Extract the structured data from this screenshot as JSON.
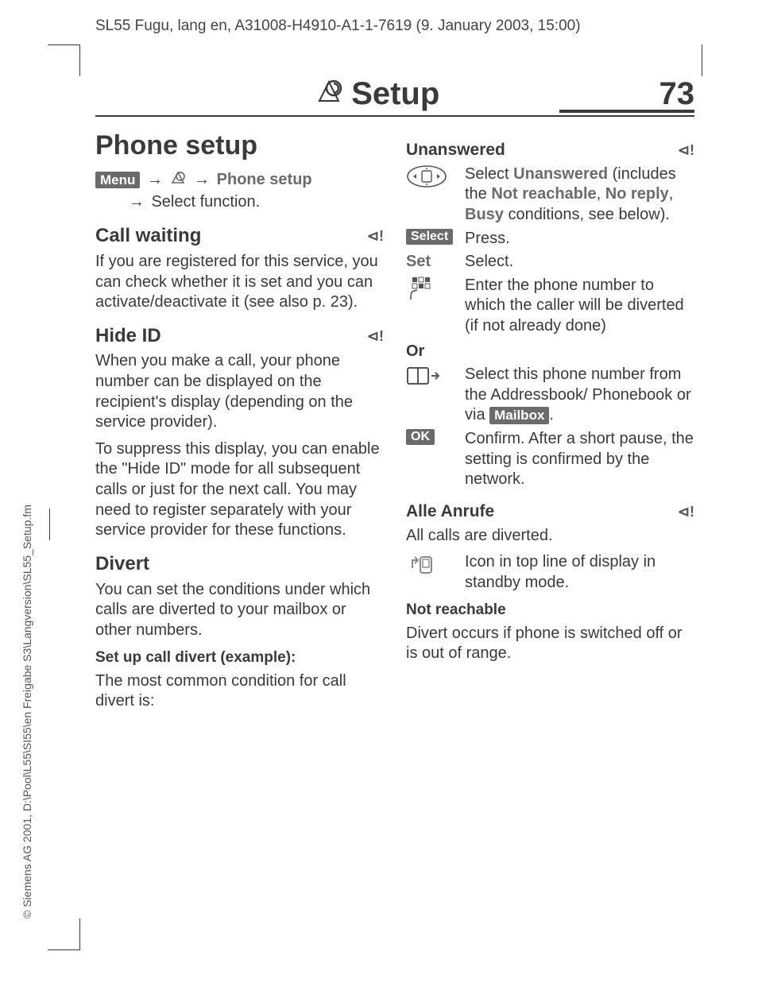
{
  "header": "SL55 Fugu, lang en, A31008-H4910-A1-1-7619 (9. January 2003, 15:00)",
  "side": "© Siemens AG 2001, D:\\Pool\\L55\\SI55\\en Freigabe S3\\Langversion\\SL55_Setup.fm",
  "page_title": "Setup",
  "page_num": "73",
  "left": {
    "h1": "Phone setup",
    "menu_label": "Menu",
    "nav_phone_setup": "Phone setup",
    "nav_select_fn": "Select function.",
    "call_waiting": {
      "title": "Call waiting",
      "body": "If you are registered for this service, you can check whether it is set and you can activate/deactivate it (see also p. 23)."
    },
    "hide_id": {
      "title": "Hide ID",
      "p1": "When you make a call, your phone number can be displayed on the recipient's display (depending on the service provider).",
      "p2": "To suppress this display, you can enable the \"Hide ID\" mode for all subsequent calls or just for the next call. You may need to register separately with your service provider for these functions."
    },
    "divert": {
      "title": "Divert",
      "p1": "You can set the conditions under which calls are diverted to your mailbox or other numbers.",
      "sub": "Set up call divert (example):",
      "p2": "The most common condition for call divert is:"
    }
  },
  "right": {
    "unanswered": {
      "title": "Unanswered",
      "step1a": "Select ",
      "step1_bold": "Unanswered",
      "step1b": " (includes the ",
      "nr": "Not reachable",
      "comma": ", ",
      "noreply": "No reply",
      "busy": "Busy",
      "step1c": " conditions, see below).",
      "select_label": "Select",
      "select_text": "Press.",
      "set_label": "Set",
      "set_text": "Select.",
      "enter_text": "Enter the phone number to which the caller will be diverted (if not already done)",
      "or": "Or",
      "addr_text_a": "Select this phone number from the Addressbook/ Phonebook or via ",
      "mailbox": "Mailbox",
      "addr_text_b": ".",
      "ok_label": "OK",
      "ok_text": "Confirm. After a short pause, the setting is confirmed by the network."
    },
    "alle": {
      "title": "Alle Anrufe",
      "p1": "All calls are diverted.",
      "icon_text": "Icon in top line of display in standby mode."
    },
    "not_reachable": {
      "title": "Not reachable",
      "p1": "Divert occurs if phone is switched off or is out of range."
    }
  }
}
